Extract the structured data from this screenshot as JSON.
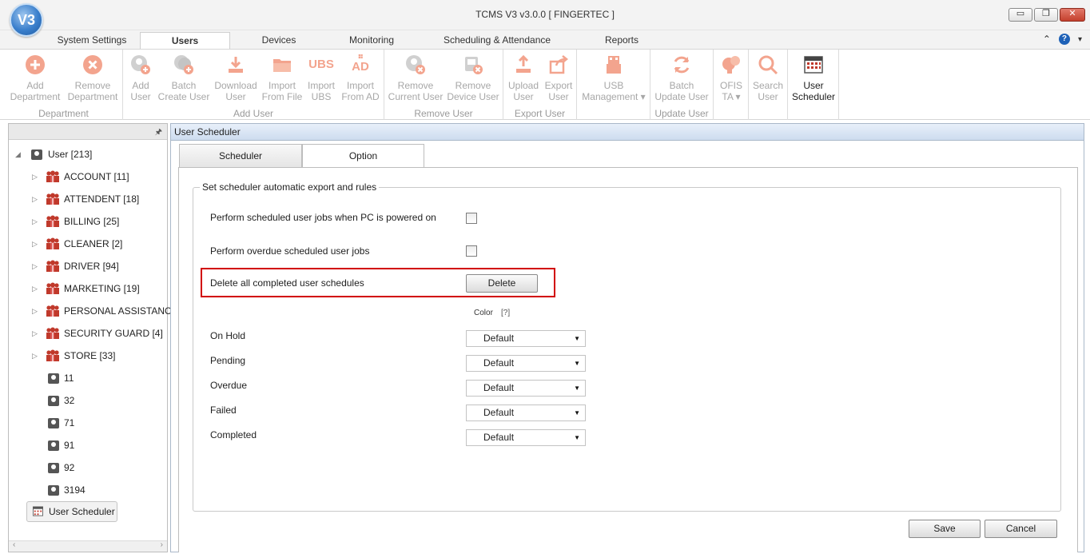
{
  "window": {
    "title": "TCMS V3 v3.0.0 [ FINGERTEC ]",
    "logo_text": "V3",
    "buttons": {
      "minimize": "▭",
      "restore": "❐",
      "close": "✕"
    }
  },
  "tabs": [
    {
      "label": "System Settings"
    },
    {
      "label": "Users"
    },
    {
      "label": "Devices"
    },
    {
      "label": "Monitoring"
    },
    {
      "label": "Scheduling & Attendance"
    },
    {
      "label": "Reports"
    }
  ],
  "tab_right": {
    "collapse": "⌃",
    "help": "?",
    "menu": "▾"
  },
  "ribbon": {
    "groups": [
      {
        "label": "Department"
      },
      {
        "label": "Add User"
      },
      {
        "label": "Remove User"
      },
      {
        "label": "Export User"
      },
      {
        "label": ""
      },
      {
        "label": "Update User"
      },
      {
        "label": ""
      },
      {
        "label": ""
      },
      {
        "label": ""
      }
    ],
    "buttons": [
      {
        "line1": "Add",
        "line2": "Department",
        "icon": "add-circle-icon"
      },
      {
        "line1": "Remove",
        "line2": "Department",
        "icon": "remove-circle-icon"
      },
      {
        "line1": "Add",
        "line2": "User",
        "icon": "add-user-icon"
      },
      {
        "line1": "Batch",
        "line2": "Create User",
        "icon": "batch-add-user-icon"
      },
      {
        "line1": "Download",
        "line2": "User",
        "icon": "download-icon"
      },
      {
        "line1": "Import",
        "line2": "From File",
        "icon": "folder-icon"
      },
      {
        "line1": "Import",
        "line2": "UBS",
        "icon": "ubs-icon",
        "icon_text": "UBS"
      },
      {
        "line1": "Import",
        "line2": "From AD",
        "icon": "windows-ad-icon",
        "icon_text": "AD"
      },
      {
        "line1": "Remove",
        "line2": "Current User",
        "icon": "remove-user-icon"
      },
      {
        "line1": "Remove",
        "line2": "Device User",
        "icon": "remove-device-user-icon"
      },
      {
        "line1": "Upload",
        "line2": "User",
        "icon": "upload-icon"
      },
      {
        "line1": "Export",
        "line2": "User",
        "icon": "export-icon"
      },
      {
        "line1": "USB",
        "line2": "Management ▾",
        "icon": "usb-icon"
      },
      {
        "line1": "Batch",
        "line2": "Update User",
        "icon": "refresh-icon"
      },
      {
        "line1": "OFIS",
        "line2": "TA ▾",
        "icon": "ofis-icon"
      },
      {
        "line1": "Search",
        "line2": "User",
        "icon": "search-icon"
      },
      {
        "line1": "User",
        "line2": "Scheduler",
        "icon": "calendar-icon"
      }
    ]
  },
  "tree": {
    "root": "User [213]",
    "departments": [
      "ACCOUNT [11]",
      "ATTENDENT [18]",
      "BILLING [25]",
      "CLEANER [2]",
      "DRIVER [94]",
      "MARKETING [19]",
      "PERSONAL ASSISTANCE",
      "SECURITY GUARD [4]",
      "STORE [33]"
    ],
    "users": [
      "11",
      "32",
      "71",
      "91",
      "92",
      "3194"
    ],
    "scheduler_node": "User Scheduler",
    "pin": "🖈",
    "scroll_left": "‹",
    "scroll_right": "›"
  },
  "main": {
    "title": "User Scheduler",
    "subtabs": [
      "Scheduler",
      "Option"
    ],
    "fieldset_legend": "Set scheduler automatic export and rules",
    "options": [
      "Perform scheduled user jobs when PC is powered on",
      "Perform overdue scheduled user jobs",
      "Delete all completed user schedules"
    ],
    "delete_button": "Delete",
    "color_label": "Color",
    "color_help": "[?]",
    "status_rows": [
      {
        "label": "On Hold",
        "value": "Default"
      },
      {
        "label": "Pending",
        "value": "Default"
      },
      {
        "label": "Overdue",
        "value": "Default"
      },
      {
        "label": "Failed",
        "value": "Default"
      },
      {
        "label": "Completed",
        "value": "Default"
      }
    ],
    "save_button": "Save",
    "cancel_button": "Cancel"
  },
  "colors": {
    "accent": "#1f62b8",
    "highlight_border": "#d10000",
    "disabled_icon": "#f3a48e",
    "group_icon": "#c0392b"
  }
}
